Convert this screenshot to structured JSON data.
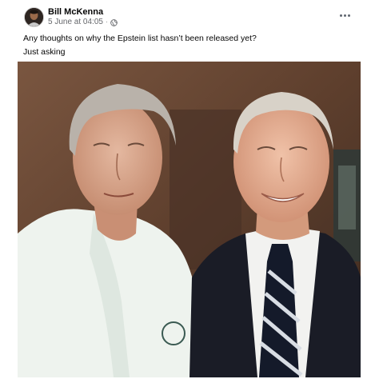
{
  "post": {
    "author": "Bill McKenna",
    "timestamp": "5 June at 04:05",
    "separator": "·",
    "privacy_icon": "globe-icon",
    "more_icon": "more-dots-icon",
    "lines": [
      "Any thoughts on why the Epstein list hasn’t been released yet?",
      "Just asking"
    ]
  },
  "colors": {
    "name": "#050505",
    "meta": "#65676b",
    "background": "#ffffff"
  }
}
